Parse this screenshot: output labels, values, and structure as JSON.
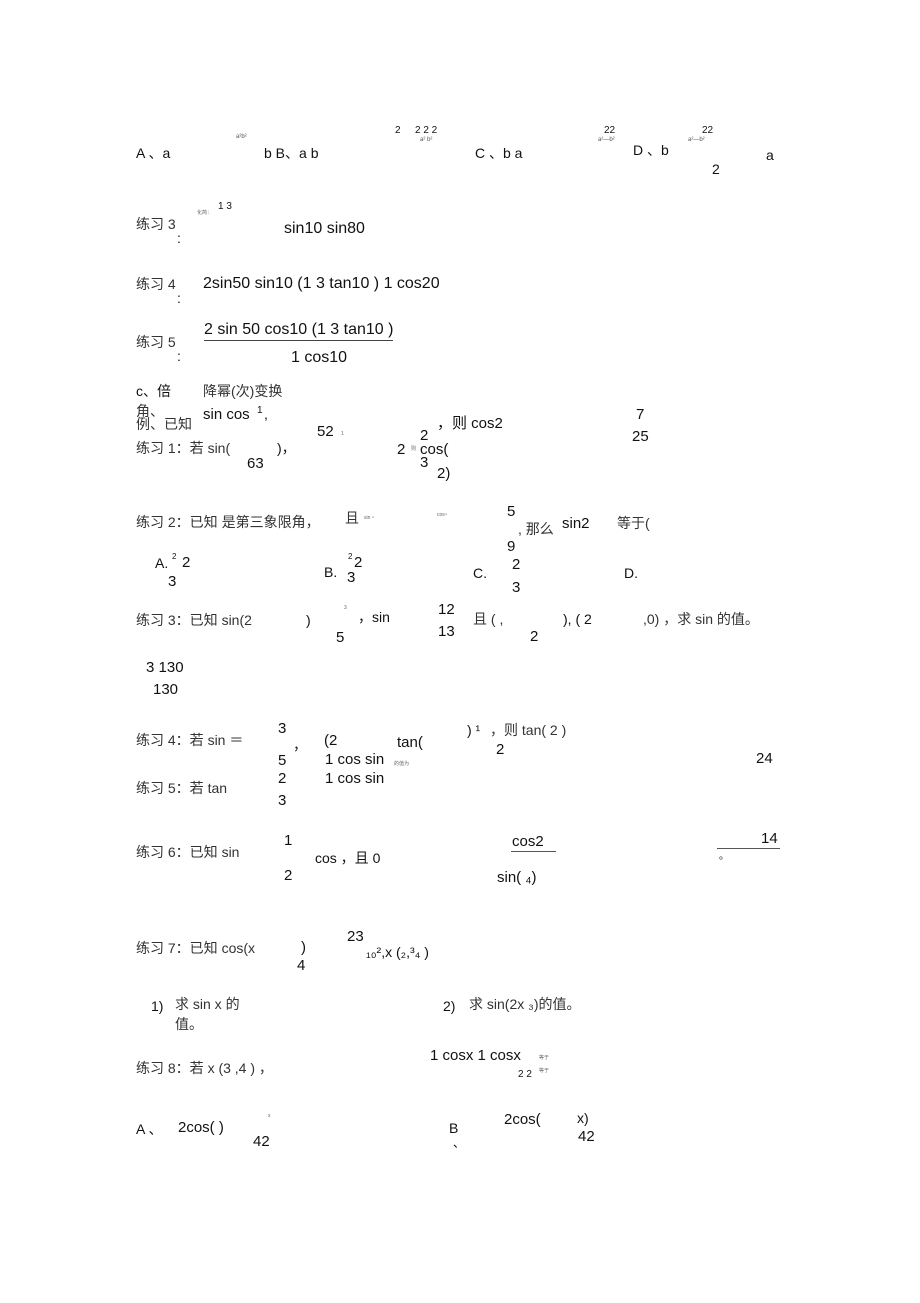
{
  "choices_top": {
    "a_label": "A 、a",
    "a_sup": "a²b²",
    "a_tail": "b B、a b",
    "b_sup1": "2",
    "b_sup2": "2 2 2",
    "b_sup3": "a² b²",
    "c_label": "C 、b a",
    "c_sup1": "22",
    "c_sup2": "a²—b²",
    "d_label": "D 、b",
    "d_sup1": "22",
    "d_sup2": "a²—b²",
    "d_den": "2",
    "d_tail": "a"
  },
  "ex3": {
    "label": "练习 3",
    "colon": ":",
    "hint": "化简：",
    "sup": "1 3",
    "expr": "sin10 sin80"
  },
  "ex4": {
    "label": "练习 4",
    "colon": ":",
    "expr": "2sin50 sin10 (1 3 tan10 ) 1 cos20"
  },
  "ex5": {
    "label": "练习 5",
    "colon": ":",
    "numerator": "2 sin 50 cos10 (1 3 tan10 )",
    "denominator": "1 cos10"
  },
  "section_c": {
    "title_left": "c、倍",
    "title_right": "降幂(次)变换",
    "sub": "角、",
    "example_label": "例、已知",
    "example_expr": "sin cos",
    "example_sup": "1",
    "example_comma": ",",
    "example_then": "，则 cos2",
    "example_answer_num": "7",
    "example_answer_den": "25"
  },
  "p1": {
    "label": "练习 1：若 sin(",
    "close": ")，",
    "den": "63",
    "frac_num": "52",
    "frac_small": "1",
    "two_a": "2",
    "then_small": "则",
    "top2": "2",
    "cos": "cos(",
    "bot3": "3",
    "tail": "2)"
  },
  "p2": {
    "label": "练习 2：已知 是第三象限角，",
    "and": "且",
    "sin4": "sin ⁴",
    "cos4": "cos⁴",
    "num": "5",
    "den": "9",
    "then": ", 那么",
    "sin2": "sin2",
    "eq": "等于(",
    "options": [
      {
        "label": "A.",
        "sup": "2",
        "num": "2",
        "den": "3"
      },
      {
        "label": "B.",
        "sup": "2",
        "num": "2",
        "den": "3"
      },
      {
        "label": "C.",
        "num": "2",
        "den": "3"
      },
      {
        "label": "D."
      }
    ]
  },
  "p3": {
    "label": "练习 3：已知 sin(2",
    "close": ")",
    "sup3": "3",
    "den5": "5",
    "sin": "，sin",
    "num12": "12",
    "den13": "13",
    "and": "且 ( ,",
    "den2": "2",
    "mid": "), ( 2",
    "tail": ",0) ，求 sin 的值。",
    "answer_num": "3 130",
    "answer_den": "130"
  },
  "p4": {
    "label": "练习 4：若 sin ＝",
    "num3": "3",
    "den5": "5",
    "comma": "，",
    "paren2": "(2",
    "expr1": "1 cos sin",
    "small": "的值为",
    "tan": "tan(",
    "close": ") ¹",
    "then": "，则 tan( 2 )",
    "den2": "2",
    "answer": "24"
  },
  "p5": {
    "label": "练习 5：若 tan",
    "num2": "2",
    "den3": "3",
    "expr2": "1 cos sin"
  },
  "p6": {
    "label": "练习 6：已知 sin",
    "num1": "1",
    "den2": "2",
    "cos": "cos ，且 0",
    "frac_num": "cos2",
    "frac_den": "sin( ₄)",
    "answer": "14",
    "period": "。"
  },
  "p7": {
    "label": "练习 7：已知 cos(x",
    "close": ")",
    "den4": "4",
    "num23": "23",
    "tail": "₁₀²,x (₂,³₄ )",
    "q1_num": "1)",
    "q1_text": "求 sin x 的",
    "q1_text2": "值。",
    "q2_num": "2)",
    "q2_text": "求 sin(2x ₃)的值。"
  },
  "p8": {
    "label": "练习 8：若 x (3 ,4 ) ，",
    "expr": "1 cosx 1 cosx",
    "small1": "等于",
    "den": "2 2",
    "small2": "等于",
    "a_label": "A 、",
    "a_expr": "2cos( )",
    "a_sup": "x",
    "a_den": "42",
    "b_label": "B",
    "b_mark": "、",
    "b_expr": "2cos(",
    "b_close": "x)",
    "b_den": "42"
  }
}
